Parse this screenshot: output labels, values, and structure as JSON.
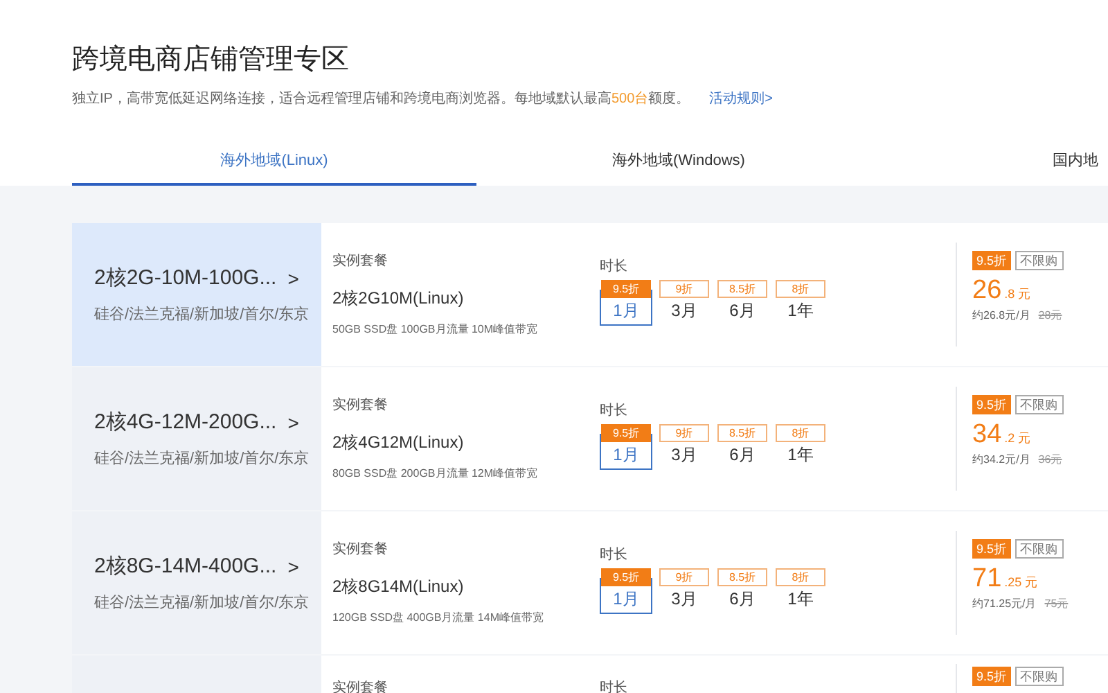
{
  "title": "跨境电商店铺管理专区",
  "subtitle": {
    "before": "独立IP，高带宽低延迟网络连接，适合远程管理店铺和跨境电商浏览器。每地域默认最高",
    "highlight": "500台",
    "after": "额度。",
    "link": "活动规则>"
  },
  "tabs": [
    {
      "label": "海外地域(Linux)",
      "selected": true
    },
    {
      "label": "海外地域(Windows)",
      "selected": false
    },
    {
      "label": "国内地",
      "selected": false
    }
  ],
  "plans": [
    {
      "name": "2核2G-10M-100G...",
      "arrow": ">",
      "regions": "硅谷/法兰克福/新加坡/首尔/东京",
      "selected": true,
      "package_label": "实例套餐",
      "package": "2核2G10M(Linux)",
      "specs": "50GB SSD盘 100GB月流量 10M峰值带宽",
      "duration_label": "时长",
      "durations": [
        {
          "discount": "9.5折",
          "label": "1月",
          "selected": true
        },
        {
          "discount": "9折",
          "label": "3月",
          "selected": false
        },
        {
          "discount": "8.5折",
          "label": "6月",
          "selected": false
        },
        {
          "discount": "8折",
          "label": "1年",
          "selected": false
        }
      ],
      "badge": "9.5折",
      "limit": "不限购",
      "price": "26",
      "price_decimal": ".8 元",
      "monthly": "约26.8元/月",
      "original": "28元"
    },
    {
      "name": "2核4G-12M-200G...",
      "arrow": ">",
      "regions": "硅谷/法兰克福/新加坡/首尔/东京",
      "selected": false,
      "package_label": "实例套餐",
      "package": "2核4G12M(Linux)",
      "specs": "80GB SSD盘 200GB月流量 12M峰值带宽",
      "duration_label": "时长",
      "durations": [
        {
          "discount": "9.5折",
          "label": "1月",
          "selected": true
        },
        {
          "discount": "9折",
          "label": "3月",
          "selected": false
        },
        {
          "discount": "8.5折",
          "label": "6月",
          "selected": false
        },
        {
          "discount": "8折",
          "label": "1年",
          "selected": false
        }
      ],
      "badge": "9.5折",
      "limit": "不限购",
      "price": "34",
      "price_decimal": ".2 元",
      "monthly": "约34.2元/月",
      "original": "36元"
    },
    {
      "name": "2核8G-14M-400G...",
      "arrow": ">",
      "regions": "硅谷/法兰克福/新加坡/首尔/东京",
      "selected": false,
      "package_label": "实例套餐",
      "package": "2核8G14M(Linux)",
      "specs": "120GB SSD盘 400GB月流量 14M峰值带宽",
      "duration_label": "时长",
      "durations": [
        {
          "discount": "9.5折",
          "label": "1月",
          "selected": true
        },
        {
          "discount": "9折",
          "label": "3月",
          "selected": false
        },
        {
          "discount": "8.5折",
          "label": "6月",
          "selected": false
        },
        {
          "discount": "8折",
          "label": "1年",
          "selected": false
        }
      ],
      "badge": "9.5折",
      "limit": "不限购",
      "price": "71",
      "price_decimal": ".25 元",
      "monthly": "约71.25元/月",
      "original": "75元"
    }
  ],
  "partial_plan": {
    "package_label": "实例套餐",
    "duration_label": "时长",
    "badge": "9.5折",
    "limit": "不限购"
  }
}
